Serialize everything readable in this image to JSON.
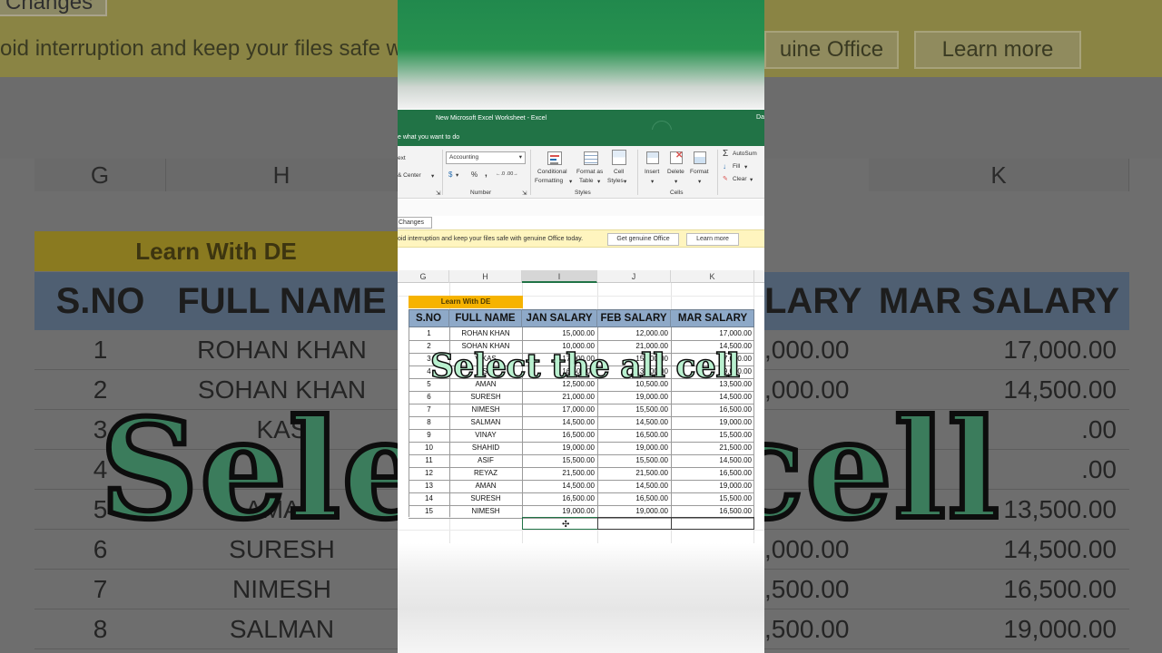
{
  "window": {
    "title": "New Microsoft Excel Worksheet  -  Excel",
    "date_fragment": "Da",
    "tell_me": "e what you want to do"
  },
  "ribbon": {
    "text_fragment": "ext",
    "merge_center": "& Center",
    "number_format": "Accounting",
    "currency_symbol": "$",
    "percent": "%",
    "comma": ",",
    "decimals": "←.0 .00→",
    "number_group": "Number",
    "conditional_formatting_line1": "Conditional",
    "conditional_formatting_line2": "Formatting",
    "format_as_table_line1": "Format as",
    "format_as_table_line2": "Table",
    "cell_styles_line1": "Cell",
    "cell_styles_line2": "Styles",
    "styles_group": "Styles",
    "insert": "Insert",
    "delete": "Delete",
    "format": "Format",
    "cells_group": "Cells",
    "autosum": "AutoSum",
    "fill": "Fill",
    "clear": "Clear"
  },
  "notification": {
    "changes_button": "Changes",
    "message": "oid interruption and keep your files safe with genuine Office today.",
    "get_genuine_button": "Get genuine Office",
    "learn_more_button": "Learn more"
  },
  "background": {
    "changes": "Changes",
    "message": "oid interruption and keep your files safe w",
    "genuine_button": "uine Office",
    "learn_more": "Learn more",
    "col_g": "G",
    "col_h": "H",
    "col_k": "K",
    "title": "Learn With DE",
    "hdr_sno": "S.NO",
    "hdr_name": "FULL NAME",
    "hdr_right_frag": "LARY",
    "hdr_mar": "MAR SALARY",
    "rows": [
      {
        "sno": "1",
        "name": "ROHAN KHAN",
        "frag": ",000.00",
        "mar": "17,000.00"
      },
      {
        "sno": "2",
        "name": "SOHAN KHAN",
        "frag": ",000.00",
        "mar": "14,500.00"
      },
      {
        "sno": "3",
        "name": "KAS",
        "frag": "",
        "mar": ".00"
      },
      {
        "sno": "4",
        "name": "",
        "frag": "",
        "mar": ".00"
      },
      {
        "sno": "5",
        "name": "AMAN",
        "frag": "",
        "mar": "13,500.00"
      },
      {
        "sno": "6",
        "name": "SURESH",
        "frag": ",000.00",
        "mar": "14,500.00"
      },
      {
        "sno": "7",
        "name": "NIMESH",
        "frag": ",500.00",
        "mar": "16,500.00"
      },
      {
        "sno": "8",
        "name": "SALMAN",
        "frag": ",500.00",
        "mar": "19,000.00"
      }
    ],
    "big_caption": "Selec    ll cell"
  },
  "sheet": {
    "columns": [
      "G",
      "H",
      "I",
      "J",
      "K"
    ],
    "title": "Learn With DE",
    "headers": {
      "sno": "S.NO",
      "name": "FULL NAME",
      "jan": "JAN SALARY",
      "feb": "FEB SALARY",
      "mar": "MAR SALARY"
    },
    "rows": [
      {
        "sno": "1",
        "name": "ROHAN KHAN",
        "jan": "15,000.00",
        "feb": "12,000.00",
        "mar": "17,000.00"
      },
      {
        "sno": "2",
        "name": "SOHAN KHAN",
        "jan": "10,000.00",
        "feb": "21,000.00",
        "mar": "14,500.00"
      },
      {
        "sno": "3",
        "name": "VIKAS",
        "jan": "17,000.00",
        "feb": "15,000.00",
        "mar": "17,000.00"
      },
      {
        "sno": "4",
        "name": "ASIF",
        "jan": "16,500.00",
        "feb": "13,000.00",
        "mar": "19,000.00"
      },
      {
        "sno": "5",
        "name": "AMAN",
        "jan": "12,500.00",
        "feb": "10,500.00",
        "mar": "13,500.00"
      },
      {
        "sno": "6",
        "name": "SURESH",
        "jan": "21,000.00",
        "feb": "19,000.00",
        "mar": "14,500.00"
      },
      {
        "sno": "7",
        "name": "NIMESH",
        "jan": "17,000.00",
        "feb": "15,500.00",
        "mar": "16,500.00"
      },
      {
        "sno": "8",
        "name": "SALMAN",
        "jan": "14,500.00",
        "feb": "14,500.00",
        "mar": "19,000.00"
      },
      {
        "sno": "9",
        "name": "VINAY",
        "jan": "16,500.00",
        "feb": "16,500.00",
        "mar": "15,500.00"
      },
      {
        "sno": "10",
        "name": "SHAHID",
        "jan": "19,000.00",
        "feb": "19,000.00",
        "mar": "21,500.00"
      },
      {
        "sno": "11",
        "name": "ASIF",
        "jan": "15,500.00",
        "feb": "15,500.00",
        "mar": "14,500.00"
      },
      {
        "sno": "12",
        "name": "REYAZ",
        "jan": "21,500.00",
        "feb": "21,500.00",
        "mar": "16,500.00"
      },
      {
        "sno": "13",
        "name": "AMAN",
        "jan": "14,500.00",
        "feb": "14,500.00",
        "mar": "19,000.00"
      },
      {
        "sno": "14",
        "name": "SURESH",
        "jan": "16,500.00",
        "feb": "16,500.00",
        "mar": "15,500.00"
      },
      {
        "sno": "15",
        "name": "NIMESH",
        "jan": "19,000.00",
        "feb": "19,000.00",
        "mar": "16,500.00"
      }
    ],
    "selected_column": "I"
  },
  "caption": "Select the all cell",
  "colors": {
    "excel_green": "#217346",
    "title_fill": "#f6b300",
    "header_fill": "#8ea9c8",
    "caption_fill": "#b9f0cf"
  },
  "icons": [
    "cursor-move-icon",
    "autosum-icon",
    "fill-icon",
    "clear-icon",
    "insert-cells-icon",
    "delete-cells-icon",
    "format-cells-icon"
  ]
}
